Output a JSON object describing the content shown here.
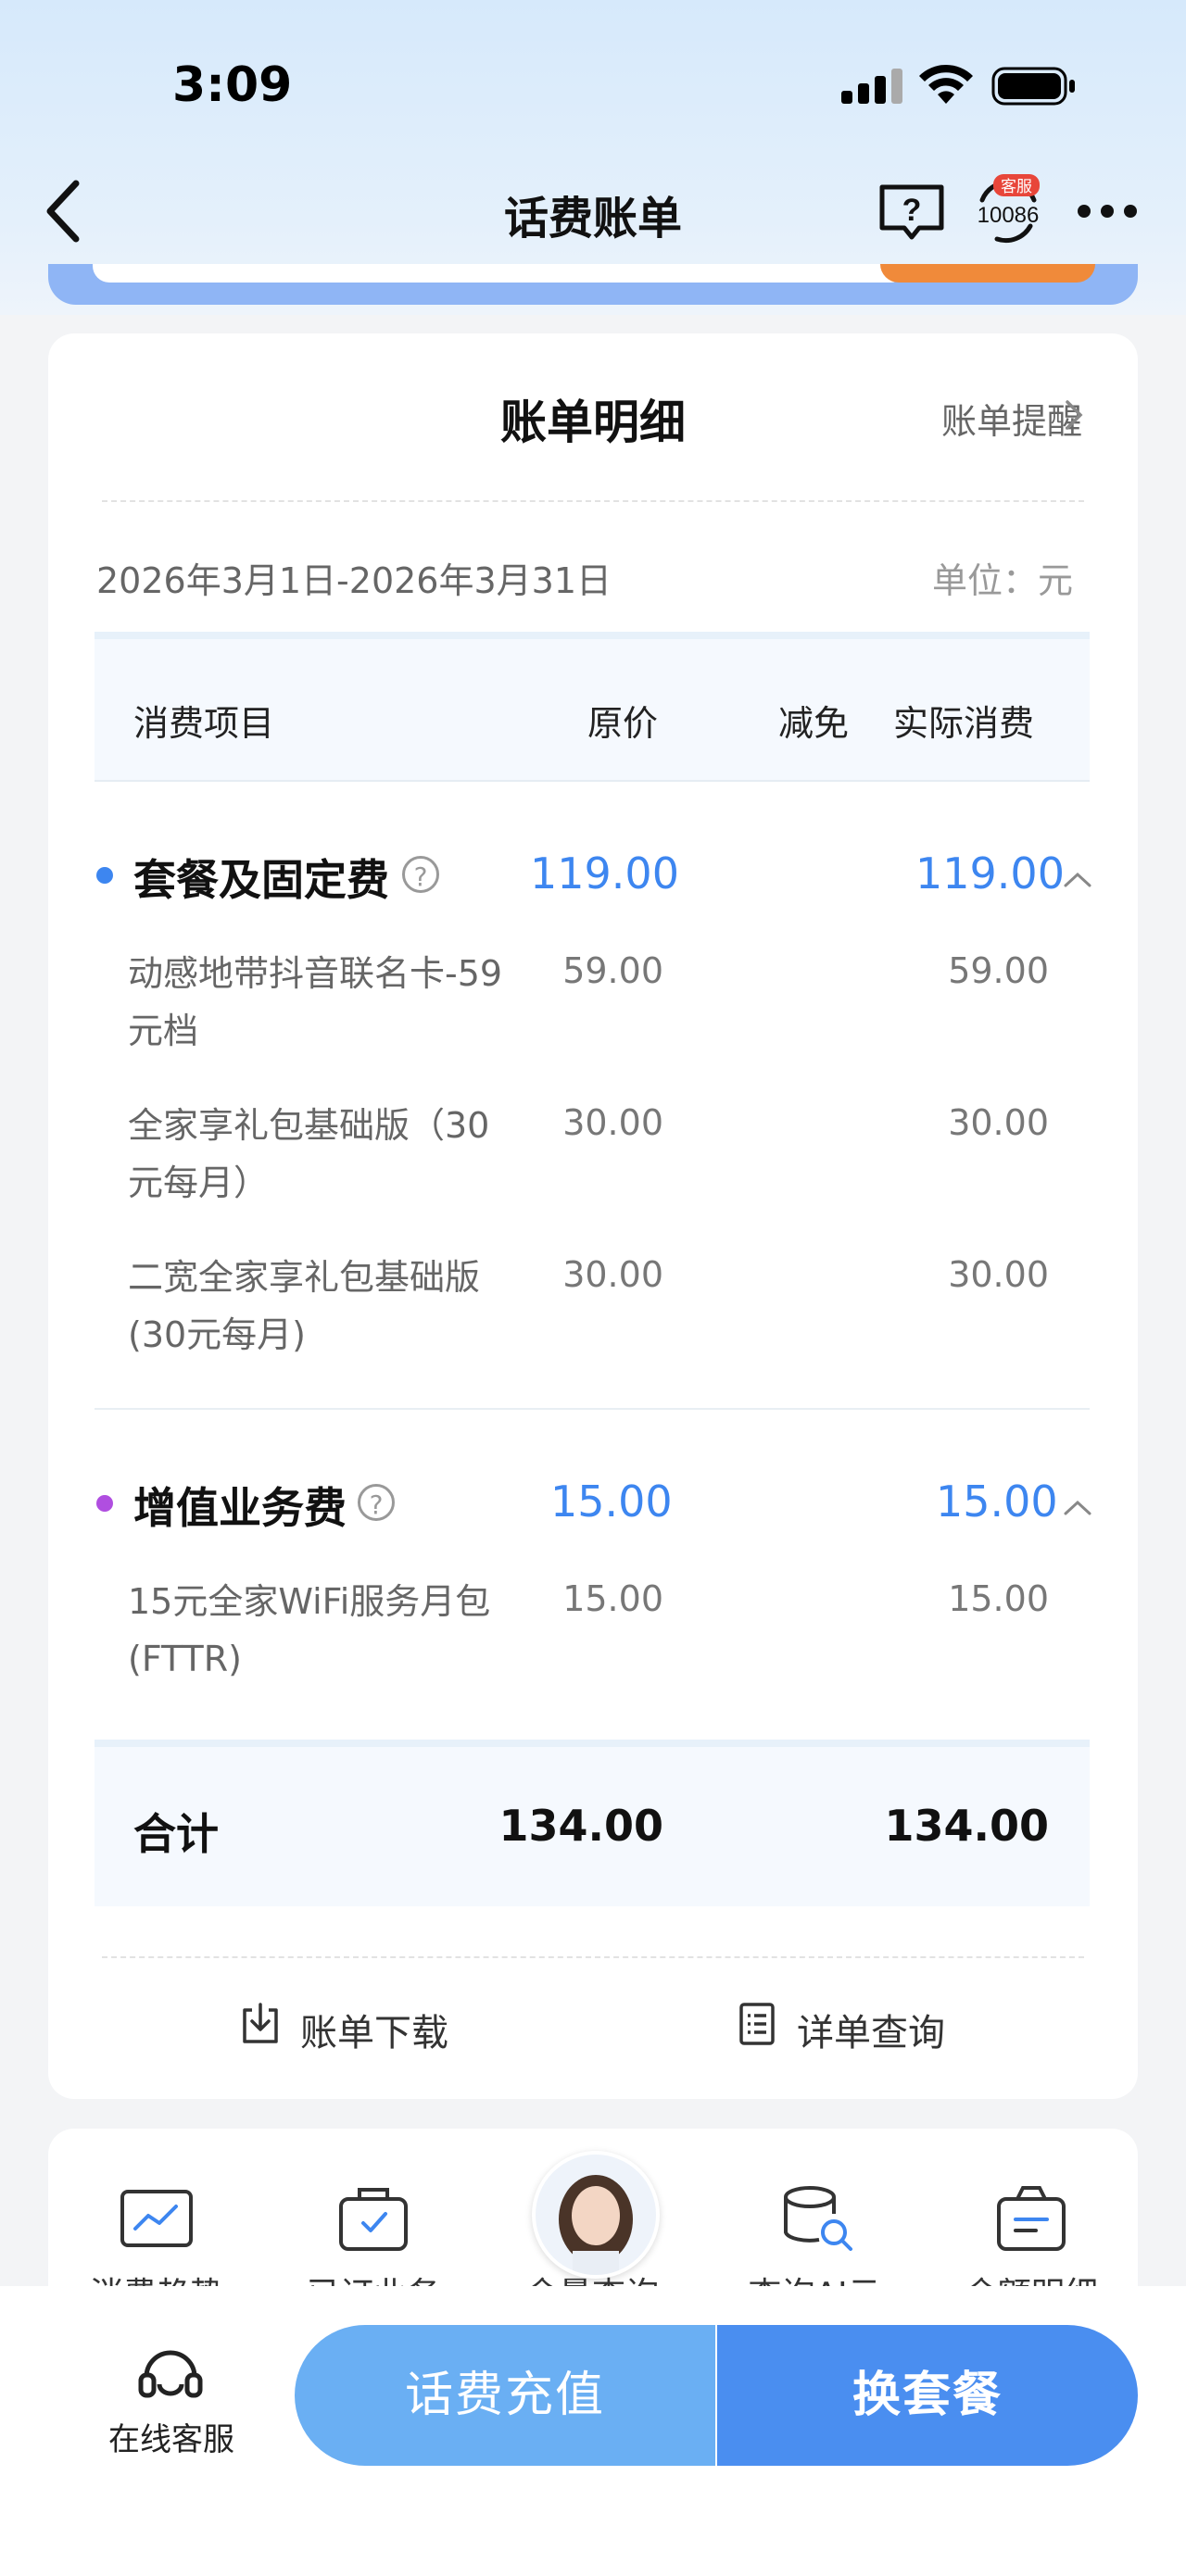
{
  "status_bar": {
    "time": "3:09"
  },
  "nav": {
    "title": "话费账单",
    "cs_badge": "客服",
    "cs_number": "10086"
  },
  "card": {
    "title": "账单明细",
    "reminder": "账单提醒",
    "period": "2026年3月1日-2026年3月31日",
    "unit": "单位：元",
    "headers": {
      "item": "消费项目",
      "original": "原价",
      "discount": "减免",
      "actual": "实际消费"
    },
    "sections": [
      {
        "title": "套餐及固定费",
        "dot_color": "#3d86f0",
        "original": "119.00",
        "actual": "119.00",
        "items": [
          {
            "name": "动感地带抖音联名卡-59元档",
            "original": "59.00",
            "actual": "59.00"
          },
          {
            "name": "全家享礼包基础版（30元每月）",
            "original": "30.00",
            "actual": "30.00"
          },
          {
            "name": "二宽全家享礼包基础版(30元每月)",
            "original": "30.00",
            "actual": "30.00"
          }
        ]
      },
      {
        "title": "增值业务费",
        "dot_color": "#b04ee0",
        "original": "15.00",
        "actual": "15.00",
        "items": [
          {
            "name": "15元全家WiFi服务月包(FTTR)",
            "original": "15.00",
            "actual": "15.00"
          }
        ]
      }
    ],
    "total": {
      "label": "合计",
      "original": "134.00",
      "actual": "134.00"
    },
    "actions": {
      "download": "账单下载",
      "detail": "详单查询"
    }
  },
  "quick_links": [
    "消费趋势",
    "已订业务",
    "余量查询",
    "查询AI云",
    "余额明细"
  ],
  "bottom": {
    "online_service": "在线客服",
    "recharge": "话费充值",
    "change_plan": "换套餐"
  },
  "colors": {
    "accent": "#3d86f0",
    "purple_dot": "#b04ee0",
    "button_light": "#6aaff3",
    "button_dark": "#4a8ef0"
  }
}
